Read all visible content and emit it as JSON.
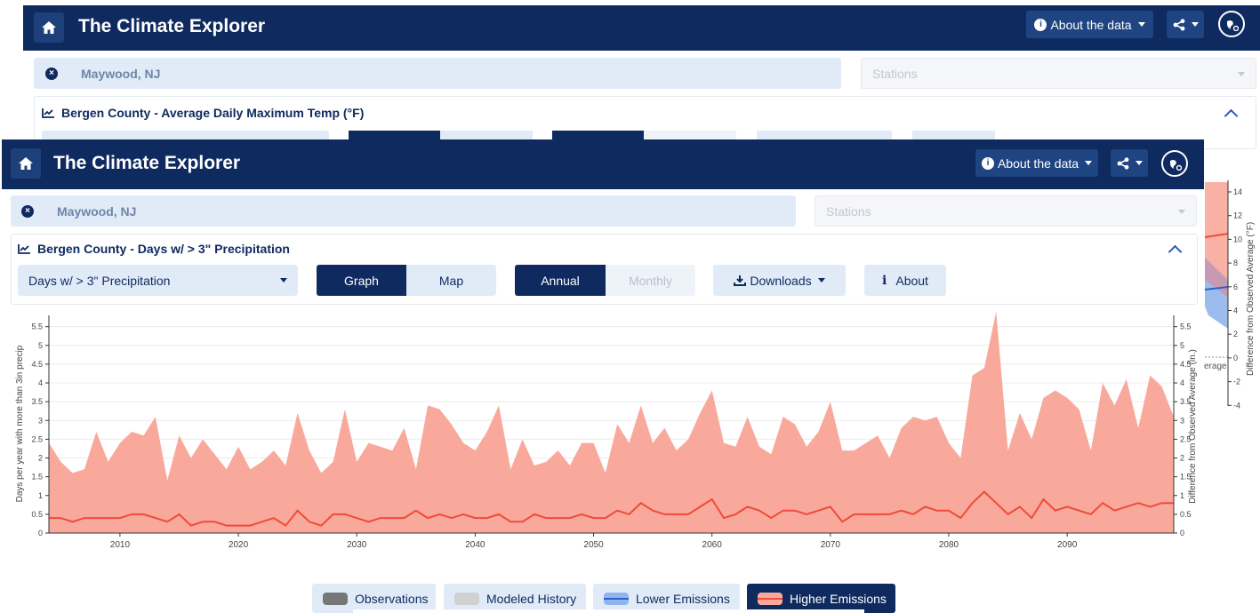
{
  "app": {
    "title": "The Climate Explorer",
    "about_label": "About the data",
    "share_icon": "share-icon",
    "globe_icon": "globe-settings-icon"
  },
  "search": {
    "location": "Maywood, NJ",
    "stations_placeholder": "Stations"
  },
  "background_panel": {
    "title": "Bergen County - Average Daily Maximum Temp (°F)"
  },
  "panel": {
    "title": "Bergen County - Days w/ > 3\" Precipitation",
    "variable_select": "Days w/ > 3\" Precipitation",
    "view_tabs": [
      "Graph",
      "Map"
    ],
    "period_tabs": [
      "Annual",
      "Monthly"
    ],
    "downloads_label": "Downloads",
    "about_label": "About"
  },
  "colors": {
    "navy": "#0e2a5f",
    "higher_band": "#f9a99b",
    "higher_line": "#f04a3a",
    "lower_band": "#8fb4ee",
    "lower_line": "#2a62c8"
  },
  "chart_data": {
    "type": "area",
    "ylabel": "Days per year with more than 3in precip",
    "y2label": "Difference from Observed Average (in.)",
    "xlim": [
      2004,
      2099
    ],
    "ylim": [
      0,
      5.8
    ],
    "x_ticks": [
      2010,
      2020,
      2030,
      2040,
      2050,
      2060,
      2070,
      2080,
      2090
    ],
    "y_ticks": [
      "0",
      "0.5",
      "1",
      "1.5",
      "2",
      "2.5",
      "3",
      "3.5",
      "4",
      "4.5",
      "5",
      "5.5"
    ],
    "y2_ticks": [
      "0",
      "0.5",
      "1",
      "1.5",
      "2",
      "2.5",
      "3",
      "3.5",
      "4",
      "4.5",
      "5",
      "5.5"
    ],
    "x": [
      2004,
      2005,
      2006,
      2007,
      2008,
      2009,
      2010,
      2011,
      2012,
      2013,
      2014,
      2015,
      2016,
      2017,
      2018,
      2019,
      2020,
      2021,
      2022,
      2023,
      2024,
      2025,
      2026,
      2027,
      2028,
      2029,
      2030,
      2031,
      2032,
      2033,
      2034,
      2035,
      2036,
      2037,
      2038,
      2039,
      2040,
      2041,
      2042,
      2043,
      2044,
      2045,
      2046,
      2047,
      2048,
      2049,
      2050,
      2051,
      2052,
      2053,
      2054,
      2055,
      2056,
      2057,
      2058,
      2059,
      2060,
      2061,
      2062,
      2063,
      2064,
      2065,
      2066,
      2067,
      2068,
      2069,
      2070,
      2071,
      2072,
      2073,
      2074,
      2075,
      2076,
      2077,
      2078,
      2079,
      2080,
      2081,
      2082,
      2083,
      2084,
      2085,
      2086,
      2087,
      2088,
      2089,
      2090,
      2091,
      2092,
      2093,
      2094,
      2095,
      2096,
      2097,
      2098,
      2099
    ],
    "series": [
      {
        "name": "Higher Emissions",
        "band_max": [
          2.4,
          1.9,
          1.6,
          1.7,
          2.7,
          1.9,
          2.4,
          2.7,
          2.6,
          3.1,
          1.4,
          2.6,
          2.0,
          2.5,
          2.1,
          1.7,
          2.3,
          1.7,
          1.9,
          2.2,
          1.8,
          3.2,
          2.2,
          1.6,
          1.9,
          3.3,
          1.9,
          2.4,
          2.3,
          2.2,
          2.8,
          1.7,
          3.4,
          3.3,
          2.9,
          2.4,
          2.2,
          2.7,
          3.4,
          1.7,
          2.5,
          1.8,
          1.9,
          2.2,
          1.8,
          2.4,
          2.4,
          1.6,
          2.9,
          2.4,
          3.4,
          2.4,
          2.8,
          2.2,
          2.5,
          3.2,
          3.8,
          2.4,
          2.3,
          3.1,
          2.3,
          2.1,
          3.1,
          2.9,
          2.3,
          2.7,
          3.5,
          2.2,
          2.2,
          2.4,
          2.6,
          2.0,
          2.8,
          3.1,
          3.0,
          3.1,
          2.4,
          2.0,
          4.2,
          4.4,
          5.9,
          2.2,
          3.2,
          2.5,
          3.6,
          3.8,
          3.6,
          3.3,
          2.2,
          4.0,
          3.4,
          4.1,
          2.8,
          4.2,
          3.9,
          3.1
        ],
        "mean": [
          0.4,
          0.4,
          0.3,
          0.4,
          0.4,
          0.4,
          0.4,
          0.5,
          0.5,
          0.4,
          0.3,
          0.5,
          0.2,
          0.3,
          0.3,
          0.2,
          0.2,
          0.2,
          0.3,
          0.4,
          0.2,
          0.6,
          0.3,
          0.2,
          0.5,
          0.5,
          0.4,
          0.3,
          0.4,
          0.4,
          0.4,
          0.6,
          0.4,
          0.5,
          0.4,
          0.5,
          0.4,
          0.4,
          0.5,
          0.3,
          0.3,
          0.5,
          0.4,
          0.4,
          0.4,
          0.5,
          0.4,
          0.4,
          0.6,
          0.5,
          0.8,
          0.6,
          0.5,
          0.5,
          0.5,
          0.7,
          0.9,
          0.4,
          0.5,
          0.7,
          0.6,
          0.4,
          0.6,
          0.6,
          0.5,
          0.6,
          0.7,
          0.3,
          0.5,
          0.5,
          0.5,
          0.5,
          0.6,
          0.5,
          0.7,
          0.6,
          0.6,
          0.4,
          0.8,
          1.1,
          0.8,
          0.5,
          0.7,
          0.4,
          0.9,
          0.6,
          0.7,
          0.6,
          0.5,
          0.8,
          0.6,
          0.7,
          0.8,
          0.7,
          0.8,
          0.8
        ]
      }
    ]
  },
  "bg_chart": {
    "y2label": "Difference from Observed Average (°F)",
    "y2_ticks": [
      "14",
      "12",
      "10",
      "8",
      "6",
      "4",
      "2",
      "0",
      "-2",
      "-4"
    ],
    "partial_label": "erage"
  },
  "legend": {
    "items": [
      {
        "label": "Observations",
        "swatch": "#777777"
      },
      {
        "label": "Modeled History",
        "swatch": "#d0d0d0"
      },
      {
        "label": "Lower Emissions",
        "swatch": "#8fb4ee"
      },
      {
        "label": "Higher Emissions",
        "swatch": "#f9a99b"
      }
    ]
  }
}
